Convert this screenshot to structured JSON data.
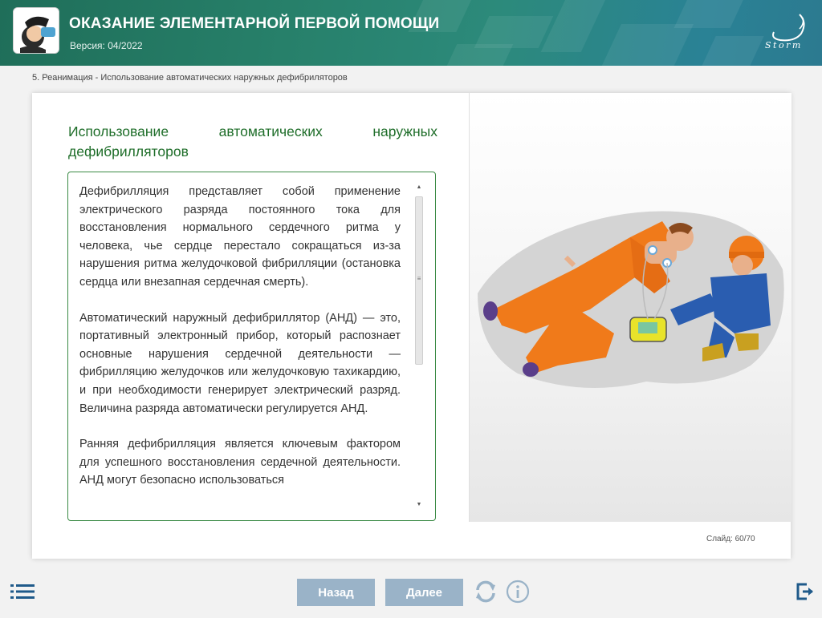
{
  "header": {
    "title": "ОКАЗАНИЕ ЭЛЕМЕНТАРНОЙ ПЕРВОЙ ПОМОЩИ",
    "version": "Версия: 04/2022",
    "brand": "Storm",
    "colors": {
      "start": "#1f6e59",
      "end": "#2c7a90"
    }
  },
  "breadcrumb": "5. Реанимация - Использование автоматических наружных дефибриляторов",
  "content": {
    "heading_words": [
      "Использование",
      "автоматических",
      "наружных"
    ],
    "heading_rest": "дефибрилляторов",
    "paragraphs": [
      "Дефибрилляция представляет собой применение электрического разряда постоянного тока для восстановления нормального сердечного ритма у человека, чье сердце перестало сокращаться из-за нарушения ритма желудочковой фибрилляции (остановка сердца или внезапная сердечная смерть).",
      "Автоматический наружный дефибриллятор (АНД) — это, портативный электронный прибор, который распознает основные нарушения сердечной деятельности — фибрилляцию желудочков или желудочковую тахикардию, и при необходимости генерирует электрический разряд. Величина разряда автоматически регулируется АНД.",
      "Ранняя дефибрилляция является ключевым фактором для успешного восстановления сердечной деятельности. АНД могут безопасно использоваться"
    ],
    "accent_color": "#1f6e2a"
  },
  "slide_counter": "Слайд: 60/70",
  "footer": {
    "back_label": "Назад",
    "next_label": "Далее",
    "button_color": "#9ab3c8",
    "icon_color": "#1f5a8a"
  },
  "icons": [
    "menu-icon",
    "reload-icon",
    "info-icon",
    "exit-icon",
    "scroll-up-icon",
    "scroll-down-icon"
  ]
}
